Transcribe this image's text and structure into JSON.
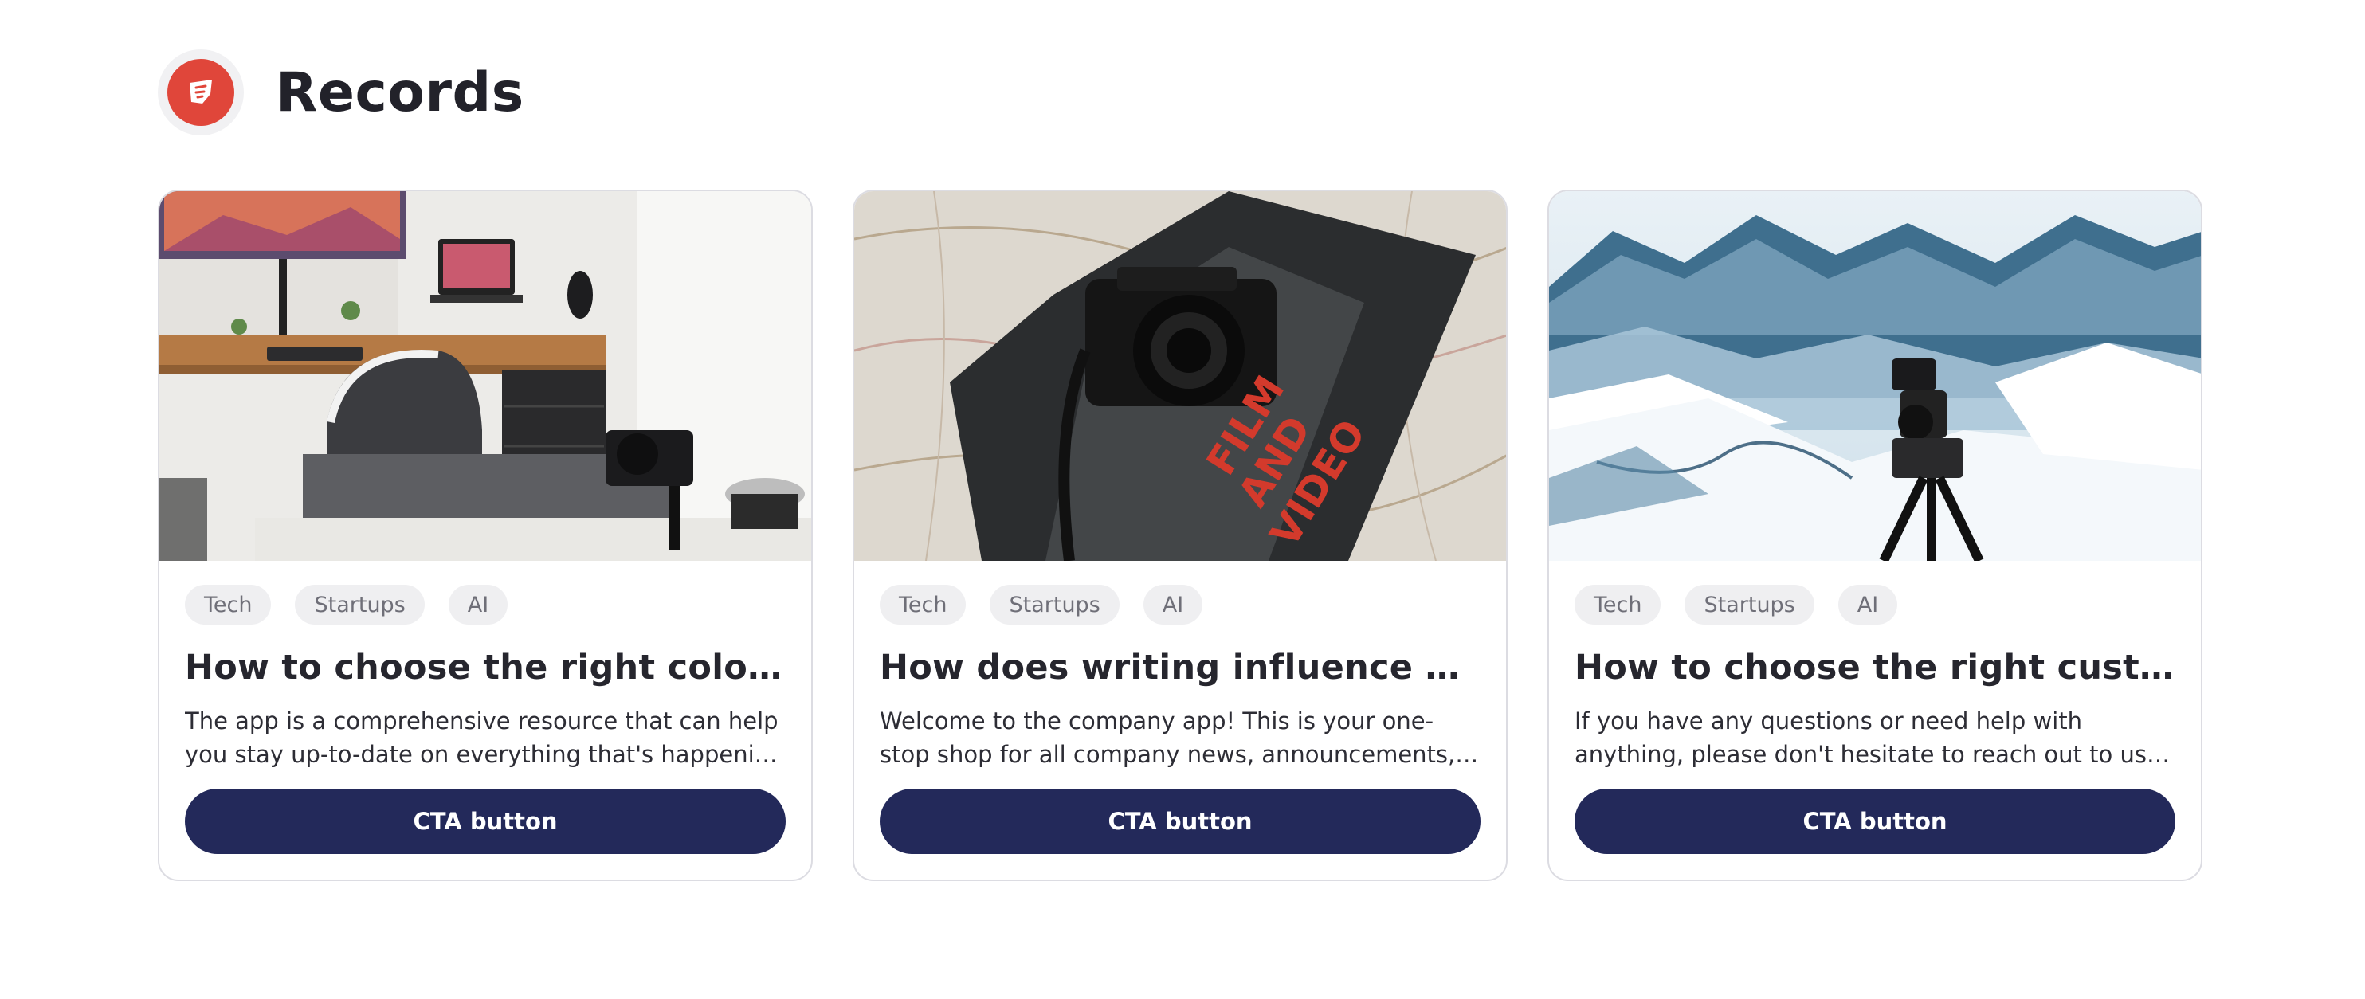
{
  "header": {
    "title": "Records",
    "logo_icon": "brand-logo-icon",
    "logo_color": "#e0463a"
  },
  "cards": [
    {
      "image": "desk-setup-photo",
      "tags": [
        "Tech",
        "Startups",
        "AI"
      ],
      "title": "How to choose the right colors when creating a palette",
      "description": "The app is a comprehensive resource that can help you stay up-to-date on everything that's happening at the company.",
      "cta_label": "CTA button"
    },
    {
      "image": "camera-on-map-photo",
      "tags": [
        "Tech",
        "Startups",
        "AI"
      ],
      "title": "How does writing influence your personal brand",
      "description": "Welcome to the company app! This is your one-stop shop for all company news, announcements, and updates.",
      "cta_label": "CTA button"
    },
    {
      "image": "snowy-mountains-photo",
      "tags": [
        "Tech",
        "Startups",
        "AI"
      ],
      "title": "How to choose the right customer for your photo business",
      "description": "If you have any questions or need help with anything, please don't hesitate to reach out to us. We're here to help.",
      "cta_label": "CTA button"
    }
  ],
  "colors": {
    "cta_background": "#23295a",
    "tag_background": "#efeff1",
    "card_border": "#dcdce2"
  }
}
